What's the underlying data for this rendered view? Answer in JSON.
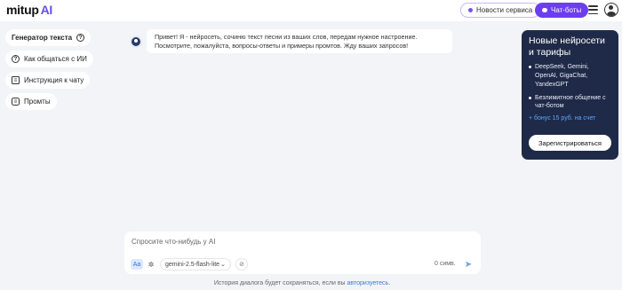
{
  "header": {
    "logo_text": "mitup",
    "logo_ai": "AI",
    "news_button": "Новости сервиса",
    "bots_button": "Чат-боты"
  },
  "sidebar": {
    "items": [
      {
        "label": "Генератор текста",
        "icon": "help-circle-icon"
      },
      {
        "label": "Как общаться с ИИ",
        "icon": "help-circle-icon"
      },
      {
        "label": "Инструкция к чату",
        "icon": "document-icon"
      },
      {
        "label": "Промты",
        "icon": "database-icon"
      }
    ]
  },
  "chat": {
    "message": "Привет! Я - нейросеть, сочиню текст песни из ваших слов, передам нужное настроение. Посмотрите, пожалуйста, вопросы-ответы и примеры промтов. Жду ваших запросов!"
  },
  "promo": {
    "title": "Новые нейросети и тарифы",
    "bullets": [
      "DeepSeek, Gemini, OpenAI, GigaChat, YandexGPT",
      "Безлимитное общение с чат-ботом"
    ],
    "bonus": "+ бонус 15 руб. на счет",
    "register_button": "Зарегистрироваться"
  },
  "composer": {
    "placeholder": "Спросите что-нибудь у AI",
    "format_label": "Aa",
    "model": "gemini-2.5-flash-lite",
    "char_count": "0 симв."
  },
  "footer": {
    "text": "История диалога будет сохраняться, если вы ",
    "link": "авторизуетесь",
    "end": "."
  },
  "colors": {
    "accent": "#6d3df0",
    "promo_bg": "#1f2a48",
    "link": "#3b7ad8"
  }
}
